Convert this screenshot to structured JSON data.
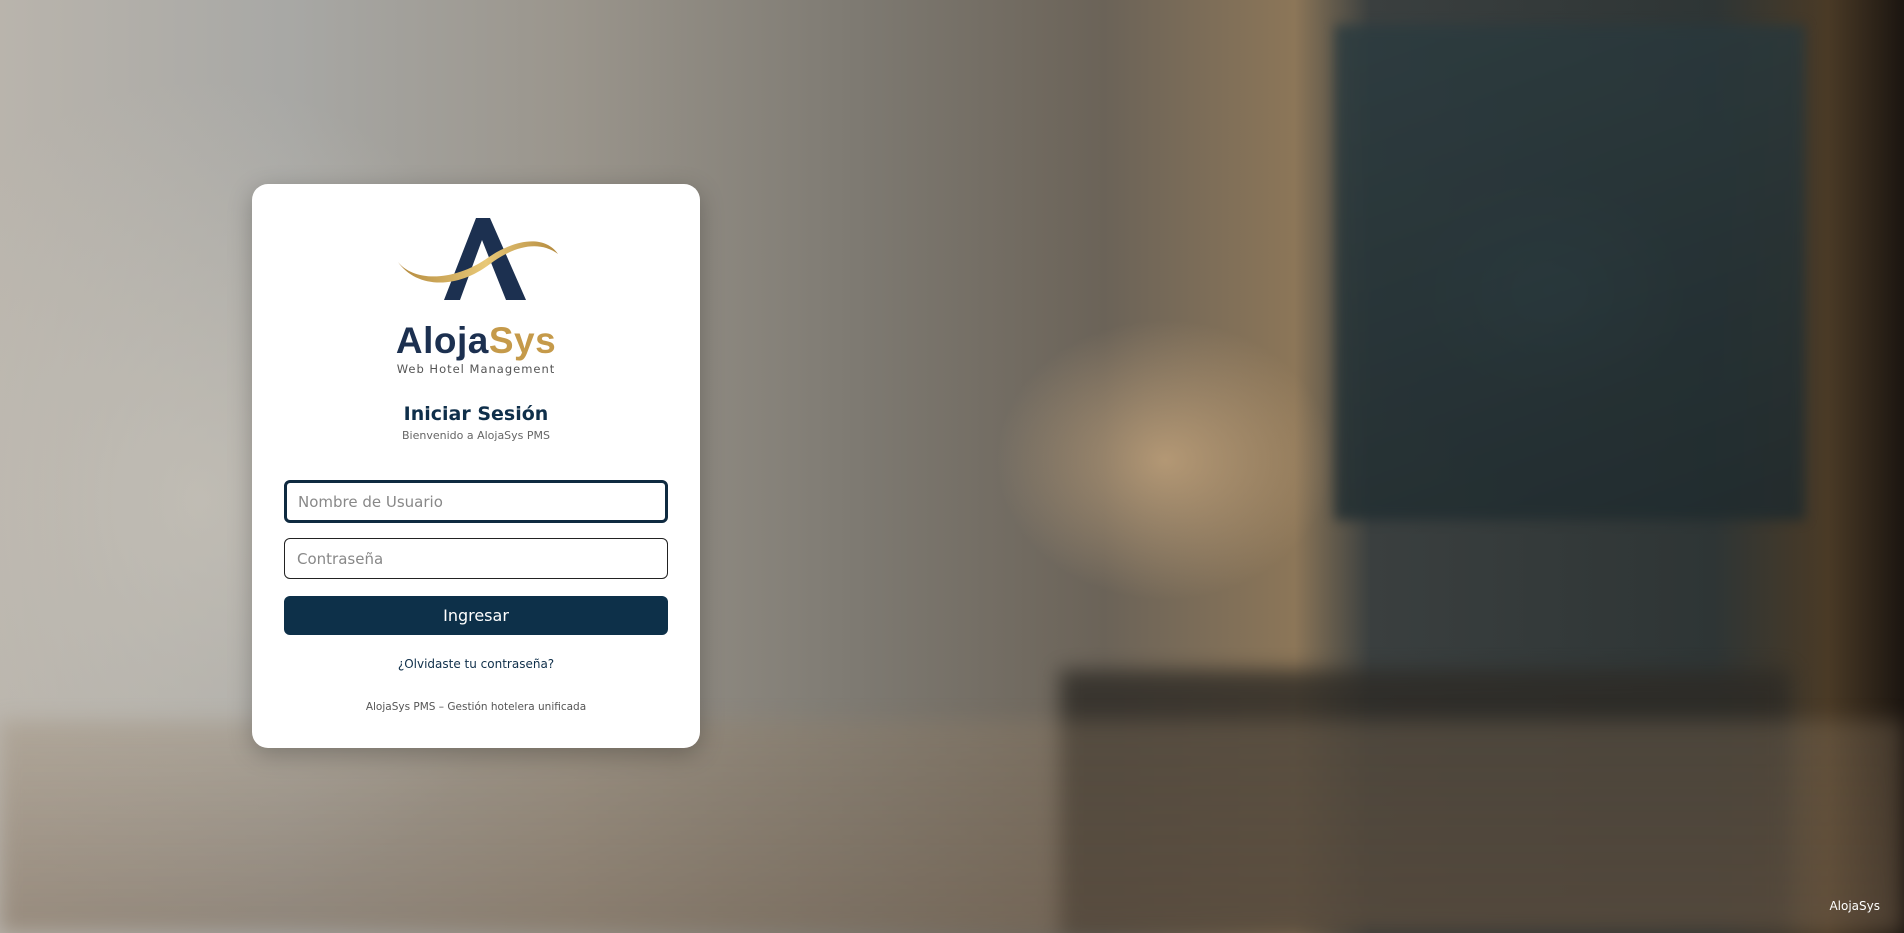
{
  "brand": {
    "name_part1": "Aloja",
    "name_part2": "Sys",
    "tagline": "Web Hotel Management",
    "color_navy": "#1c3050",
    "color_gold": "#c59a4a"
  },
  "login": {
    "title": "Iniciar Sesión",
    "subtitle": "Bienvenido a AlojaSys PMS",
    "username_placeholder": "Nombre de Usuario",
    "password_placeholder": "Contraseña",
    "submit_label": "Ingresar",
    "forgot_link": "¿Olvidaste tu contraseña?",
    "footer": "AlojaSys PMS – Gestión hotelera unificada"
  },
  "corner_label": "AlojaSys"
}
